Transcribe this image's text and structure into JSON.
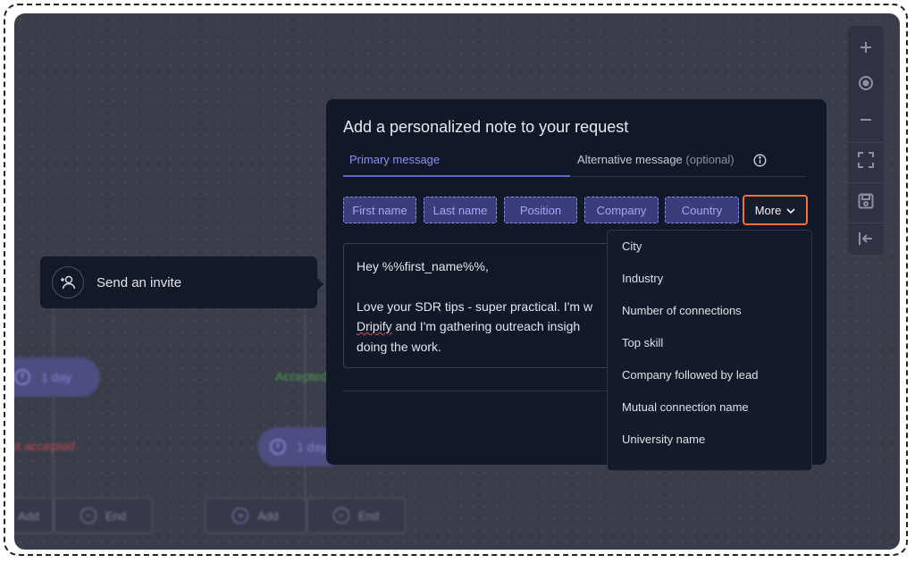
{
  "flow": {
    "invite_node_label": "Send an invite",
    "delay_left": "1 day",
    "delay_right": "1 day",
    "branch_not_accepted": "If not accepted",
    "branch_accepted": "Accepted",
    "add_label": "Add",
    "end_label": "End"
  },
  "toolbar": {
    "icons": [
      "zoom-in-icon",
      "center-icon",
      "zoom-out-icon",
      "fit-screen-icon",
      "save-icon",
      "exit-icon"
    ]
  },
  "modal": {
    "title": "Add a personalized note to your request",
    "tab_primary": "Primary message",
    "tab_alternative": "Alternative message",
    "tab_alternative_optional": "(optional)",
    "variables": [
      "First name",
      "Last name",
      "Position",
      "Company",
      "Country"
    ],
    "more_label": "More",
    "message": {
      "line1": "Hey %%first_name%%,",
      "line2": "Love your SDR tips - super practical. I'm w",
      "line3_word": "Dripify",
      "line3_rest": " and I'm gathering outreach insigh",
      "line4": "doing the work."
    }
  },
  "dropdown": {
    "items": [
      "City",
      "Industry",
      "Number of connections",
      "Top skill",
      "Company followed by lead",
      "Mutual connection name",
      "University name"
    ]
  },
  "colors": {
    "accent": "#6266c8",
    "highlight_border": "#f07040",
    "not_accepted": "#d9534f",
    "accepted": "#4caf50"
  }
}
